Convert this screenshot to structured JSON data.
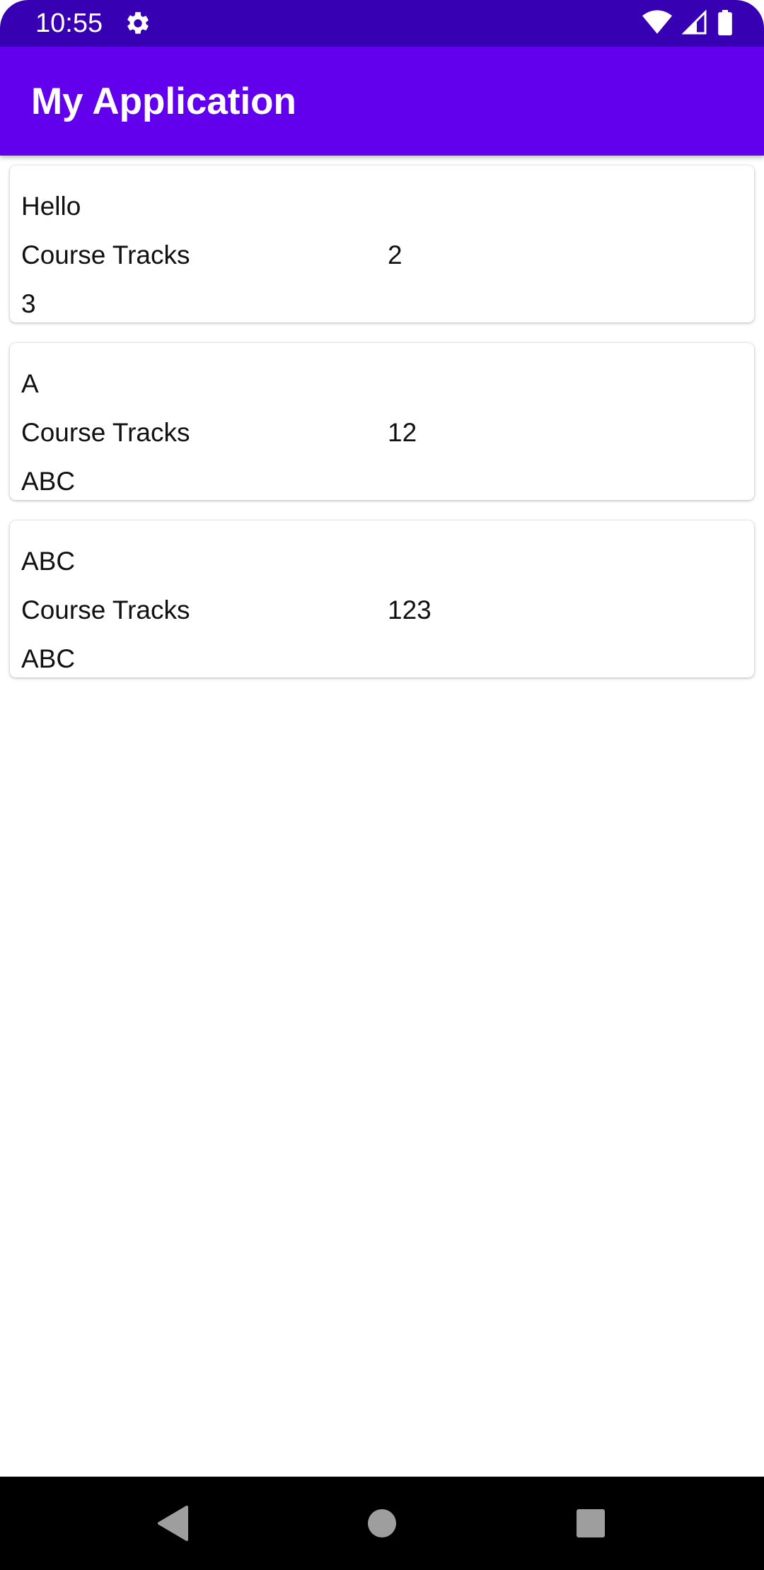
{
  "status_bar": {
    "time": "10:55",
    "icons": [
      "gear-icon",
      "wifi-icon",
      "cell-signal-icon",
      "battery-icon"
    ]
  },
  "app_bar": {
    "title": "My Application"
  },
  "cards": [
    {
      "title": "Hello",
      "label": "Course Tracks",
      "value": "2",
      "footer": "3"
    },
    {
      "title": "A",
      "label": "Course Tracks",
      "value": "12",
      "footer": "ABC"
    },
    {
      "title": "ABC",
      "label": "Course Tracks",
      "value": "123",
      "footer": "ABC"
    }
  ],
  "nav_bar": {
    "icons": [
      "back-icon",
      "home-icon",
      "recents-icon"
    ]
  },
  "colors": {
    "status_bar": "#3700b3",
    "app_bar": "#6200ee",
    "nav_bar": "#000000",
    "nav_icon": "#9e9e9e"
  }
}
